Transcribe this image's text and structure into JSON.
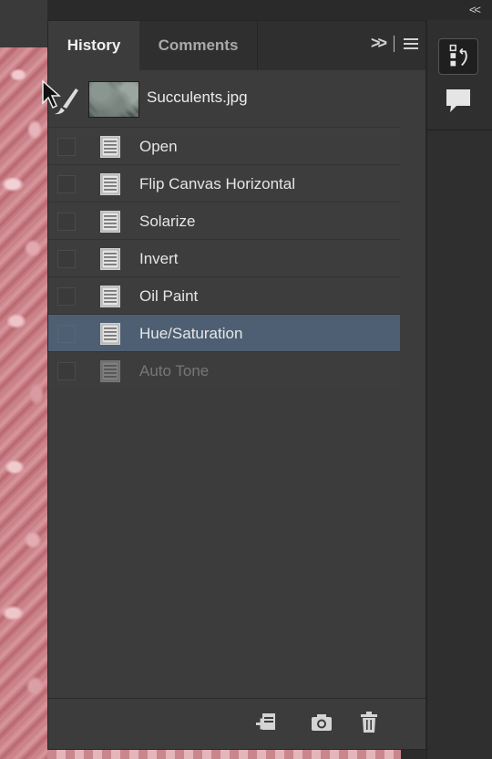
{
  "panel": {
    "tabs": [
      {
        "label": "History",
        "active": true
      },
      {
        "label": "Comments",
        "active": false
      }
    ],
    "expand_label": ">>"
  },
  "snapshot": {
    "name": "Succulents.jpg"
  },
  "history": [
    {
      "label": "Open",
      "state": "normal"
    },
    {
      "label": "Flip Canvas Horizontal",
      "state": "normal"
    },
    {
      "label": "Solarize",
      "state": "normal"
    },
    {
      "label": "Invert",
      "state": "normal"
    },
    {
      "label": "Oil Paint",
      "state": "normal"
    },
    {
      "label": "Hue/Saturation",
      "state": "selected"
    },
    {
      "label": "Auto Tone",
      "state": "dimmed"
    }
  ],
  "collapse_label": "<<",
  "footer": {
    "icons": [
      "new-document-from-state-icon",
      "camera-snapshot-icon",
      "trash-icon"
    ]
  },
  "colors": {
    "selected_row": "#4e5f73",
    "panel_bg": "#3c3c3c"
  }
}
